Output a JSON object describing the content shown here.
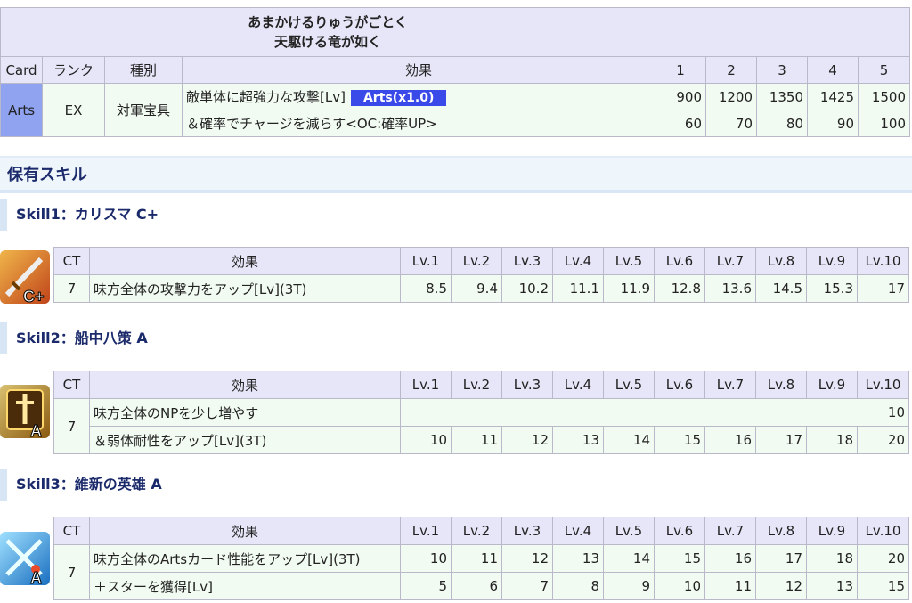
{
  "np": {
    "title_line1": "あまかけるりゅうがごとく",
    "title_line2": "天駆ける竜が如く",
    "headers": [
      "Card",
      "ランク",
      "種別",
      "効果",
      "1",
      "2",
      "3",
      "4",
      "5"
    ],
    "card": "Arts",
    "rank": "EX",
    "type": "対軍宝具",
    "effect1": "敵単体に超強力な攻撃[Lv]",
    "badge": "Arts(x1.0)",
    "values1": [
      "900",
      "1200",
      "1350",
      "1425",
      "1500"
    ],
    "effect2": "＆確率でチャージを減らす<OC:確率UP>",
    "values2": [
      "60",
      "70",
      "80",
      "90",
      "100"
    ]
  },
  "section_title": "保有スキル",
  "skill_headers": [
    "CT",
    "効果",
    "Lv.1",
    "Lv.2",
    "Lv.3",
    "Lv.4",
    "Lv.5",
    "Lv.6",
    "Lv.7",
    "Lv.8",
    "Lv.9",
    "Lv.10"
  ],
  "skills": [
    {
      "title": "Skill1：カリスマ C+",
      "ct": "7",
      "rank_label": "C+",
      "effect1": "味方全体の攻撃力をアップ[Lv](3T)",
      "values1": [
        "8.5",
        "9.4",
        "10.2",
        "11.1",
        "11.9",
        "12.8",
        "13.6",
        "14.5",
        "15.3",
        "17"
      ]
    },
    {
      "title": "Skill2：船中八策 A",
      "ct": "7",
      "rank_label": "A",
      "effect1": "味方全体のNPを少し増やす",
      "fixed1": "10",
      "effect2": "＆弱体耐性をアップ[Lv](3T)",
      "values2": [
        "10",
        "11",
        "12",
        "13",
        "14",
        "15",
        "16",
        "17",
        "18",
        "20"
      ]
    },
    {
      "title": "Skill3：維新の英雄 A",
      "ct": "7",
      "rank_label": "A",
      "effect1": "味方全体のArtsカード性能をアップ[Lv](3T)",
      "values1": [
        "10",
        "11",
        "12",
        "13",
        "14",
        "15",
        "16",
        "17",
        "18",
        "20"
      ],
      "effect2": "＋スターを獲得[Lv]",
      "values2": [
        "5",
        "6",
        "7",
        "8",
        "9",
        "10",
        "11",
        "12",
        "13",
        "15"
      ]
    }
  ],
  "icons": [
    "sword-skill-icon",
    "sword-emblem-skill-icon",
    "crossed-swords-skill-icon"
  ]
}
